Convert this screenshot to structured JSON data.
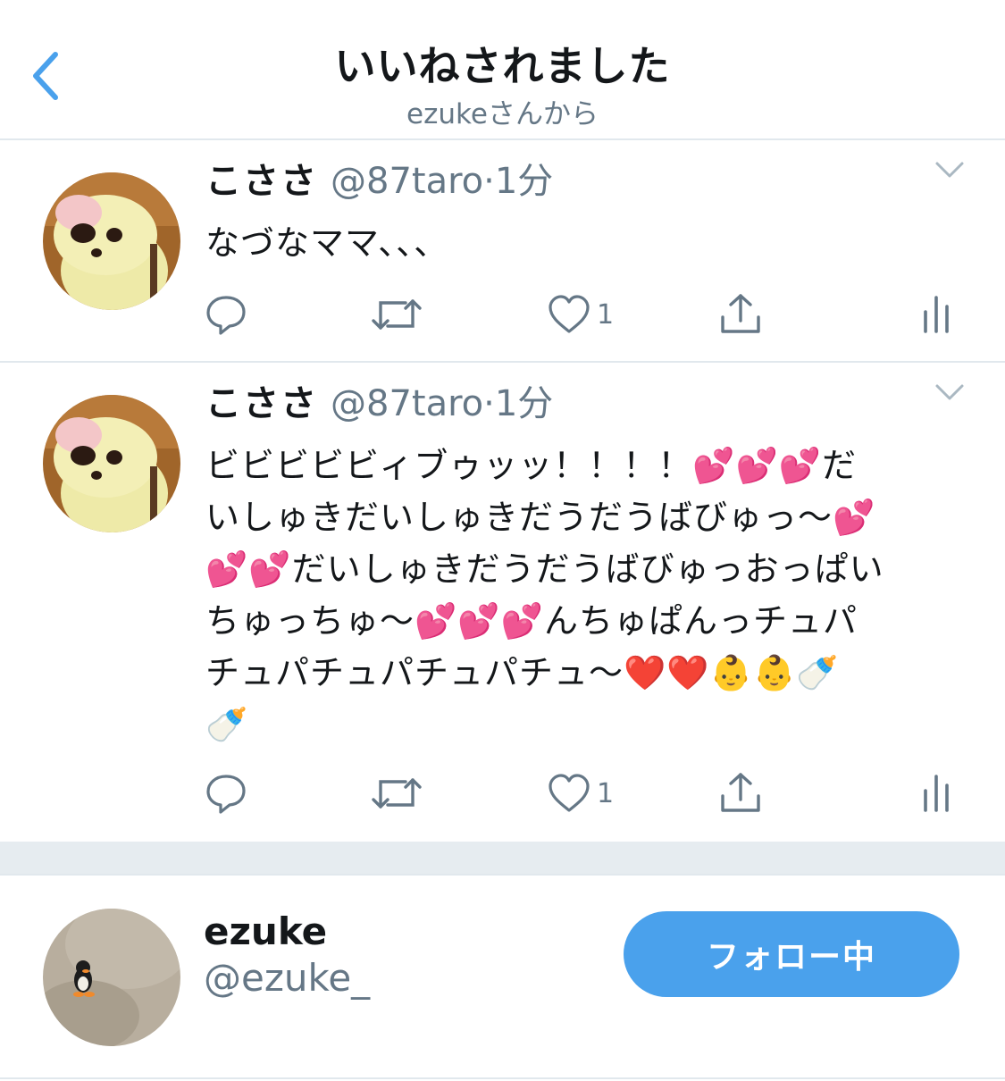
{
  "header": {
    "title": "いいねされました",
    "subtitle": "ezukeさんから"
  },
  "tweets": [
    {
      "name": "こささ",
      "handle": "@87taro",
      "dot": "·",
      "time": "1分",
      "text": "なづなママ、、、",
      "like_count": "1"
    },
    {
      "name": "こささ",
      "handle": "@87taro",
      "dot": "·",
      "time": "1分",
      "lines": [
        "ビビビビビィブゥッッ！！！！💕💕💕だ",
        "いしゅきだいしゅきだうだうばびゅっ〜💕",
        "💕💕だいしゅきだうだうばびゅっおっぱい",
        "ちゅっちゅ〜💕💕💕んちゅぱんっチュパ",
        "チュパチュパチュパチュ〜❤️❤️👶👶🍼",
        "🍼"
      ],
      "like_count": "1"
    }
  ],
  "user": {
    "name": "ezuke",
    "handle": "@ezuke_",
    "follow_label": "フォロー中"
  },
  "colors": {
    "accent": "#4aa1ec",
    "secondary_text": "#657786",
    "divider": "#e1e8ed",
    "gap": "#e6ecf0"
  }
}
